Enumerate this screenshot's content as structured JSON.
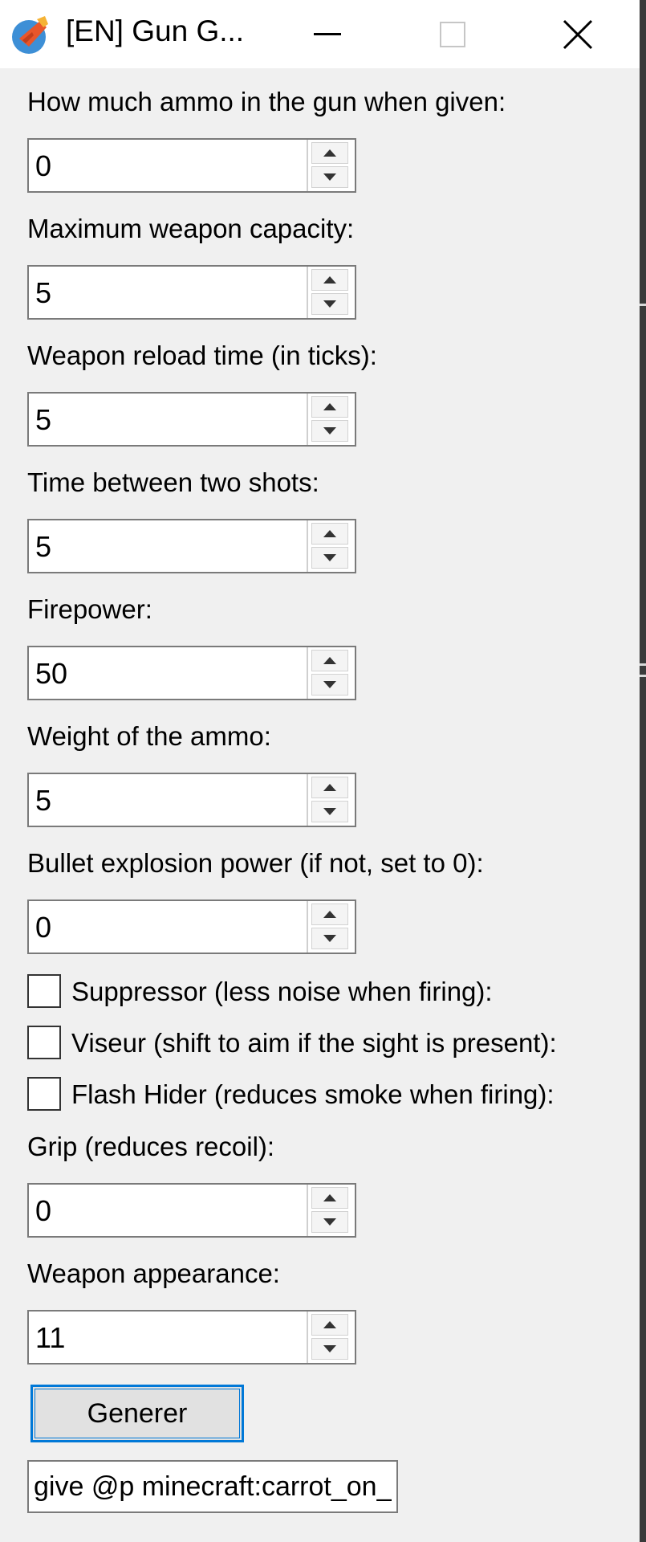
{
  "window": {
    "title": "[EN] Gun G..."
  },
  "fields": [
    {
      "label": "How much ammo in the gun when given:",
      "value": "0"
    },
    {
      "label": "Maximum weapon capacity:",
      "value": "5"
    },
    {
      "label": "Weapon reload time (in ticks):",
      "value": "5"
    },
    {
      "label": "Time between two shots:",
      "value": "5"
    },
    {
      "label": "Firepower:",
      "value": "50"
    },
    {
      "label": "Weight of the ammo:",
      "value": "5"
    },
    {
      "label": "Bullet explosion power (if not, set to 0):",
      "value": "0"
    }
  ],
  "checkboxes": [
    {
      "label": "Suppressor (less noise when firing):",
      "checked": false
    },
    {
      "label": "Viseur (shift to aim if the sight is present):",
      "checked": false
    },
    {
      "label": "Flash Hider (reduces smoke when firing):",
      "checked": false
    }
  ],
  "grip": {
    "label": "Grip (reduces recoil):",
    "value": "0"
  },
  "appearance": {
    "label": "Weapon appearance:",
    "value": "11"
  },
  "generate_button": {
    "label": "Generer"
  },
  "output": {
    "value": "give @p minecraft:carrot_on_a_stick"
  },
  "icons": {
    "app": "app-logo-icon",
    "minimize": "minimize-icon",
    "maximize": "maximize-icon",
    "close": "close-icon",
    "spin_up": "arrow-up-icon",
    "spin_down": "arrow-down-icon"
  },
  "colors": {
    "window_bg": "#f0f0f0",
    "focus_accent": "#0078d7"
  }
}
